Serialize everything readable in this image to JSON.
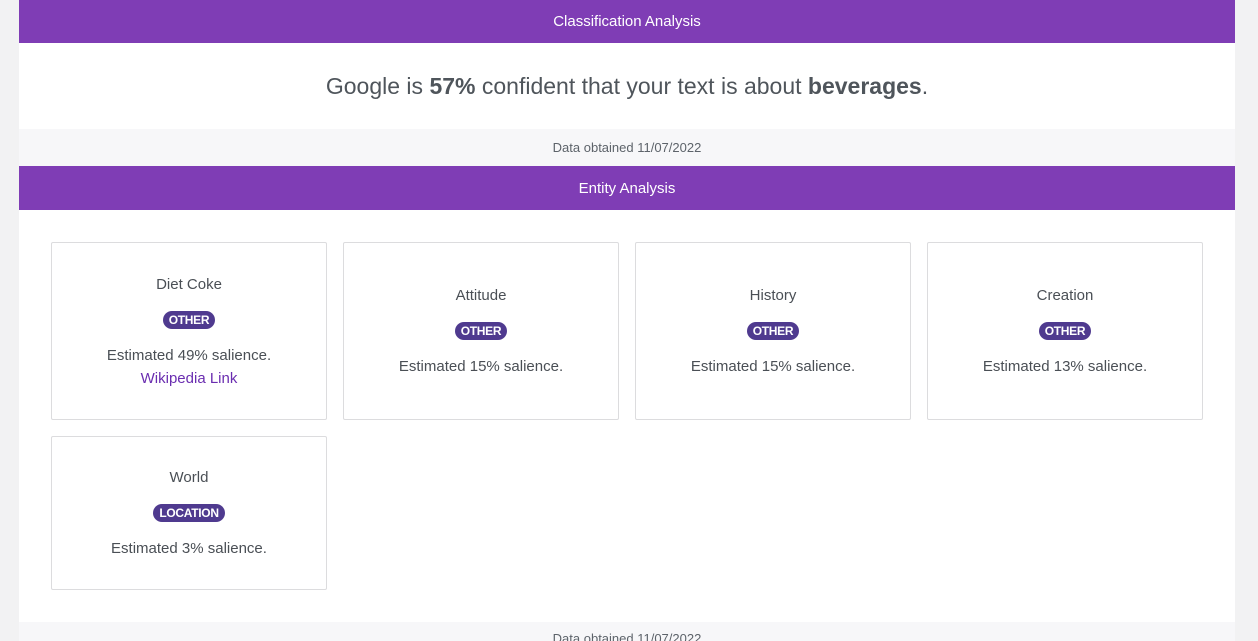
{
  "classification": {
    "header": "Classification Analysis",
    "sentence_prefix": "Google is ",
    "confidence": "57%",
    "sentence_middle": " confident that your text is about ",
    "category": "beverages",
    "sentence_suffix": ".",
    "footer": "Data obtained 11/07/2022"
  },
  "entity": {
    "header": "Entity Analysis",
    "cards": [
      {
        "name": "Diet Coke",
        "type": "OTHER",
        "salience": "Estimated 49% salience.",
        "link": "Wikipedia Link"
      },
      {
        "name": "Attitude",
        "type": "OTHER",
        "salience": "Estimated 15% salience."
      },
      {
        "name": "History",
        "type": "OTHER",
        "salience": "Estimated 15% salience."
      },
      {
        "name": "Creation",
        "type": "OTHER",
        "salience": "Estimated 13% salience."
      },
      {
        "name": "World",
        "type": "LOCATION",
        "salience": "Estimated 3% salience."
      }
    ],
    "footer": "Data obtained 11/07/2022"
  },
  "colors": {
    "header_bar": "#7f3db5",
    "badge": "#4f3a8f",
    "link": "#6a2db0"
  }
}
